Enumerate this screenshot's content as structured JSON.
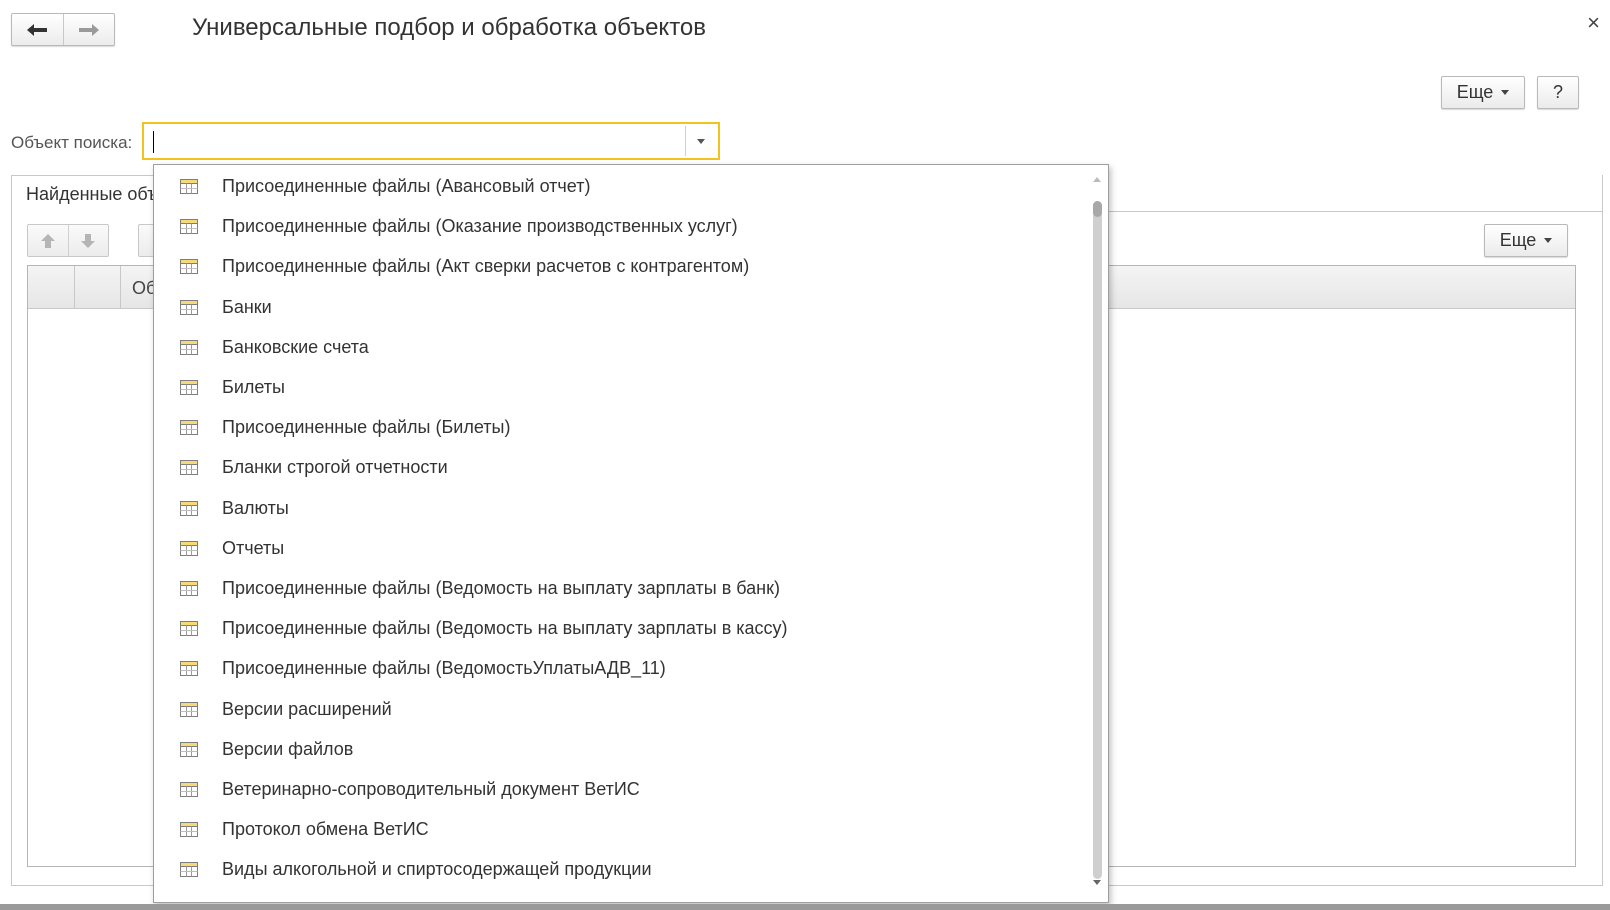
{
  "window": {
    "title": "Универсальные подбор и обработка объектов",
    "close_glyph": "×"
  },
  "toolbar": {
    "more_label": "Еще",
    "help_label": "?"
  },
  "search": {
    "label": "Объект поиска:",
    "value": "",
    "placeholder": ""
  },
  "tab": {
    "label": "Найденные объекты"
  },
  "grid": {
    "more_label": "Еще",
    "column_header_partial": "Об"
  },
  "dropdown": {
    "items": [
      "Присоединенные файлы (Авансовый отчет)",
      "Присоединенные файлы (Оказание производственных услуг)",
      "Присоединенные файлы (Акт сверки расчетов с контрагентом)",
      "Банки",
      "Банковские счета",
      "Билеты",
      "Присоединенные файлы (Билеты)",
      "Бланки строгой отчетности",
      "Валюты",
      "Отчеты",
      "Присоединенные файлы (Ведомость на выплату зарплаты в банк)",
      "Присоединенные файлы (Ведомость на выплату зарплаты в кассу)",
      "Присоединенные файлы (ВедомостьУплатыАДВ_11)",
      "Версии расширений",
      "Версии файлов",
      "Ветеринарно-сопроводительный документ ВетИС",
      "Протокол обмена ВетИС",
      "Виды алкогольной и спиртосодержащей продукции"
    ],
    "item_icon": "table-icon"
  },
  "colors": {
    "focus_border": "#f3c31d",
    "icon_fill": "#f5d97a"
  }
}
